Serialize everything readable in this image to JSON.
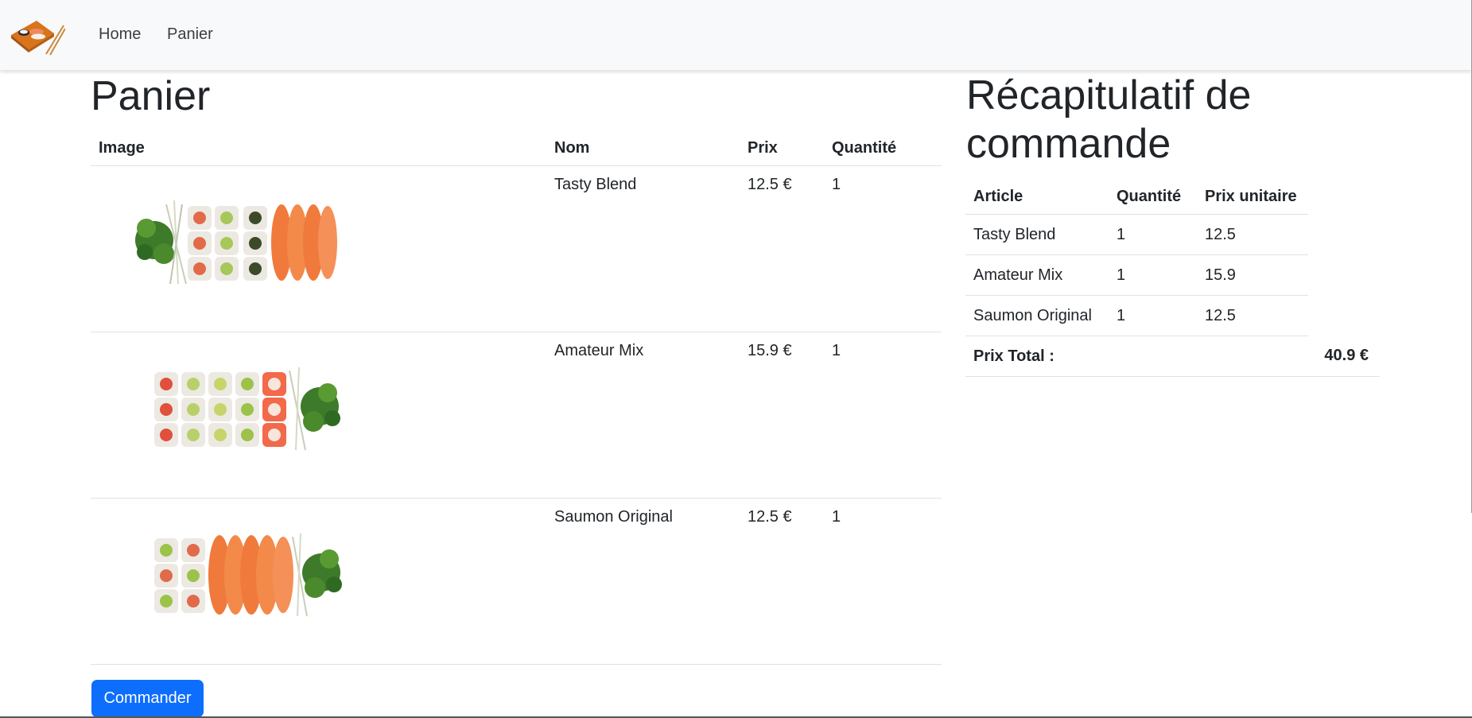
{
  "nav": {
    "logo_icon": "sushi-tray-logo-icon",
    "home_label": "Home",
    "panier_label": "Panier"
  },
  "cart": {
    "title": "Panier",
    "headers": {
      "image": "Image",
      "nom": "Nom",
      "prix": "Prix",
      "quantite": "Quantité"
    },
    "items": [
      {
        "image_icon": "sushi-tasty-blend-image",
        "name": "Tasty Blend",
        "price": "12.5 €",
        "quantity": "1"
      },
      {
        "image_icon": "sushi-amateur-mix-image",
        "name": "Amateur Mix",
        "price": "15.9 €",
        "quantity": "1"
      },
      {
        "image_icon": "sushi-saumon-original-image",
        "name": "Saumon Original",
        "price": "12.5 €",
        "quantity": "1"
      }
    ],
    "order_button": "Commander"
  },
  "summary": {
    "title": "Récapitulatif de commande",
    "headers": {
      "article": "Article",
      "quantite": "Quantité",
      "prix_unitaire": "Prix unitaire"
    },
    "rows": [
      {
        "article": "Tasty Blend",
        "quantity": "1",
        "unit_price": "12.5"
      },
      {
        "article": "Amateur Mix",
        "quantity": "1",
        "unit_price": "15.9"
      },
      {
        "article": "Saumon Original",
        "quantity": "1",
        "unit_price": "12.5"
      }
    ],
    "total_label": "Prix Total :",
    "total_value": "40.9 €"
  },
  "colors": {
    "navbar_bg": "#f8f9fa",
    "button_primary": "#0d6efd",
    "text": "#212529",
    "border": "#dee2e6"
  }
}
